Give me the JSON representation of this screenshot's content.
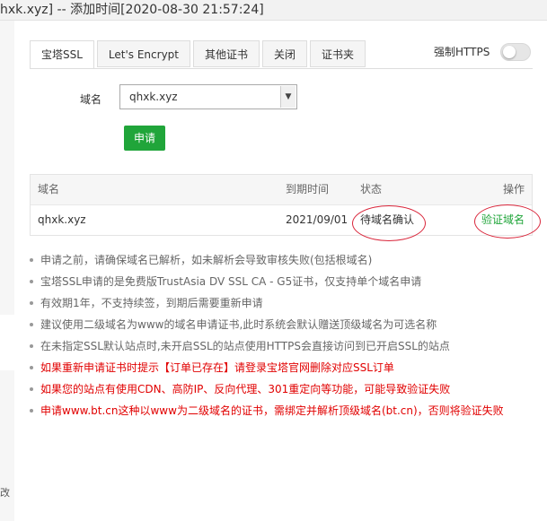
{
  "window": {
    "title": "hxk.xyz] -- 添加时间[2020-08-30 21:57:24]"
  },
  "tabs": [
    {
      "label": "宝塔SSL",
      "active": true
    },
    {
      "label": "Let's Encrypt",
      "active": false
    },
    {
      "label": "其他证书",
      "active": false
    },
    {
      "label": "关闭",
      "active": false
    },
    {
      "label": "证书夹",
      "active": false
    }
  ],
  "force_https": {
    "label": "强制HTTPS",
    "enabled": false
  },
  "form": {
    "domain_label": "域名",
    "domain_value": "qhxk.xyz",
    "apply_label": "申请"
  },
  "table": {
    "headers": [
      "域名",
      "到期时间",
      "状态",
      "操作"
    ],
    "rows": [
      {
        "domain": "qhxk.xyz",
        "expires": "2021/09/01",
        "status": "待域名确认",
        "action": "验证域名"
      }
    ]
  },
  "notes": [
    {
      "text": "申请之前，请确保域名已解析，如未解析会导致审核失败(包括根域名)",
      "warn": false
    },
    {
      "text": "宝塔SSL申请的是免费版TrustAsia DV SSL CA - G5证书，仅支持单个域名申请",
      "warn": false
    },
    {
      "text": "有效期1年，不支持续签，到期后需要重新申请",
      "warn": false
    },
    {
      "text": "建议使用二级域名为www的域名申请证书,此时系统会默认赠送顶级域名为可选名称",
      "warn": false
    },
    {
      "text": "在未指定SSL默认站点时,未开启SSL的站点使用HTTPS会直接访问到已开启SSL的站点",
      "warn": false
    },
    {
      "text": "如果重新申请证书时提示【订单已存在】请登录宝塔官网删除对应SSL订单",
      "warn": true
    },
    {
      "text": "如果您的站点有使用CDN、高防IP、反向代理、301重定向等功能，可能导致验证失败",
      "warn": true
    },
    {
      "text": "申请www.bt.cn这种以www为二级域名的证书，需绑定并解析顶级域名(bt.cn)，否则将验证失败",
      "warn": true
    }
  ],
  "side": {
    "glyph": "改"
  },
  "colors": {
    "accent": "#20a53a",
    "warn": "#e10000",
    "annotation": "#d9253a"
  },
  "icons": {
    "select_arrow": "chevron-down-icon",
    "bullet": "bullet-dot-icon"
  }
}
